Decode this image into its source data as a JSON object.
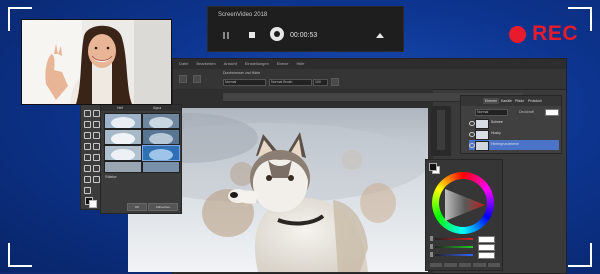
{
  "recording": {
    "rec_label": "REC",
    "rec_color": "#e81b2c"
  },
  "recorder": {
    "title": "ScreenVideo 2018",
    "elapsed_time": "00:00:53",
    "icons": [
      "pause-icon",
      "stop-icon",
      "webcam-icon",
      "collapse-icon"
    ]
  },
  "editor": {
    "menu": [
      "Datei",
      "Bearbeiten",
      "Ansicht",
      "Einstellungen",
      "Ebene",
      "Hilfe"
    ],
    "options": {
      "label_a": "Durchmesser und Härte",
      "field_a": "Normal",
      "field_b": "Normal Brush",
      "field_c": "100"
    },
    "filters": {
      "header": [
        "Hell",
        "Aqua"
      ],
      "caption": "Stärke",
      "buttons": [
        "OK",
        "Abbrechen"
      ]
    },
    "layers": {
      "tabs": [
        "Ebenen",
        "Kanäle",
        "Pfade",
        "Protokoll"
      ],
      "blend_mode": "Normal",
      "opacity_label": "Deckkraft",
      "rows": [
        {
          "name": "Schnee",
          "selected": false
        },
        {
          "name": "Husky",
          "selected": false
        },
        {
          "name": "Hintergrundebene",
          "selected": true
        }
      ]
    },
    "color": {
      "fg": "#111111",
      "bg": "#ffffff"
    }
  },
  "colors": {
    "accent": "#4b73c9",
    "desktop": "#0d3590"
  }
}
